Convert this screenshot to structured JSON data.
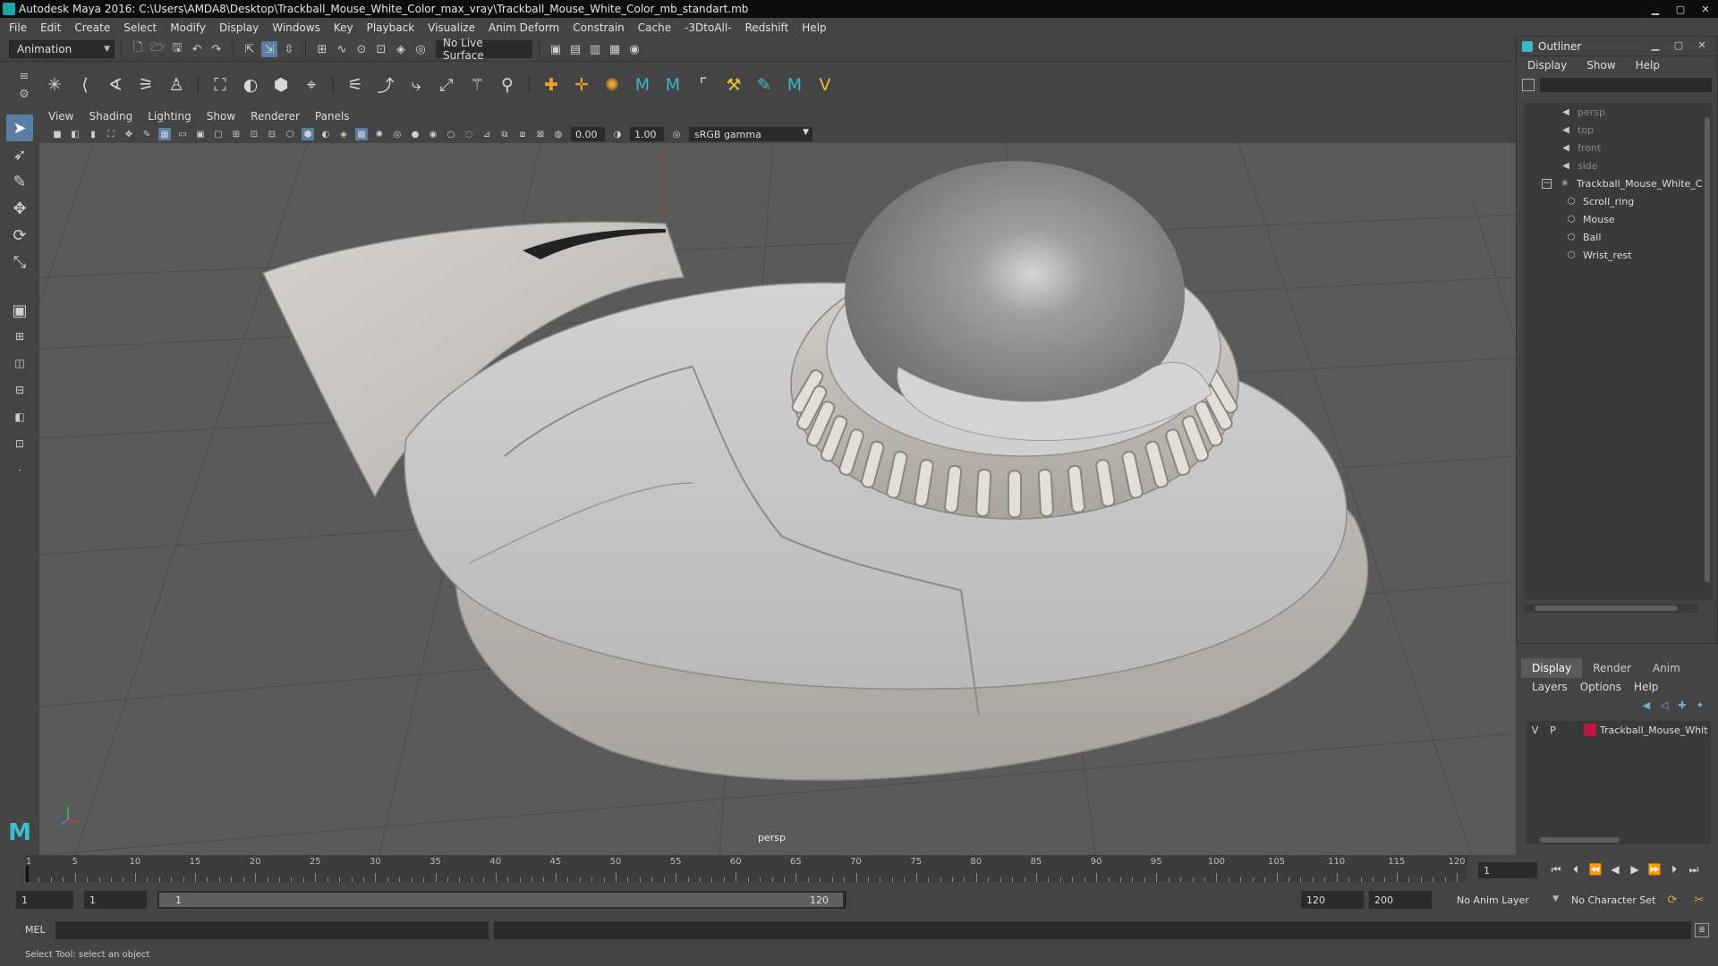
{
  "window": {
    "title": "Autodesk Maya 2016: C:\\Users\\AMDA8\\Desktop\\Trackball_Mouse_White_Color_max_vray\\Trackball_Mouse_White_Color_mb_standart.mb",
    "controls": [
      "minimize-icon",
      "maximize-icon",
      "close-icon"
    ]
  },
  "menubar": [
    "File",
    "Edit",
    "Create",
    "Select",
    "Modify",
    "Display",
    "Windows",
    "Key",
    "Playback",
    "Visualize",
    "Anim Deform",
    "Constrain",
    "Cache",
    "-3DtoAll-",
    "Redshift",
    "Help"
  ],
  "statusline": {
    "mode": "Animation",
    "live_surface": "No Live Surface"
  },
  "viewport": {
    "menus": [
      "View",
      "Shading",
      "Lighting",
      "Show",
      "Renderer",
      "Panels"
    ],
    "exposure": "0.00",
    "gamma": "1.00",
    "color_space": "sRGB gamma",
    "camera_label": "persp"
  },
  "outliner": {
    "title": "Outliner",
    "menus": [
      "Display",
      "Show",
      "Help"
    ],
    "items": [
      {
        "label": "persp",
        "type": "camera",
        "dim": true
      },
      {
        "label": "top",
        "type": "camera",
        "dim": true
      },
      {
        "label": "front",
        "type": "camera",
        "dim": true
      },
      {
        "label": "side",
        "type": "camera",
        "dim": true
      },
      {
        "label": "Trackball_Mouse_White_C",
        "type": "group",
        "expanded": true
      },
      {
        "label": "Scroll_ring",
        "type": "mesh"
      },
      {
        "label": "Mouse",
        "type": "mesh"
      },
      {
        "label": "Ball",
        "type": "mesh"
      },
      {
        "label": "Wrist_rest",
        "type": "mesh"
      }
    ]
  },
  "layers": {
    "tabs": [
      "Display",
      "Render",
      "Anim"
    ],
    "active_tab": "Display",
    "menus": [
      "Layers",
      "Options",
      "Help"
    ],
    "rows": [
      {
        "visible": "V",
        "playback": "P",
        "name": "Trackball_Mouse_Whit",
        "color": "#c0183c"
      }
    ]
  },
  "timeline": {
    "tick_labels": [
      "1",
      "5",
      "10",
      "15",
      "20",
      "25",
      "30",
      "35",
      "40",
      "45",
      "50",
      "55",
      "60",
      "65",
      "70",
      "75",
      "80",
      "85",
      "90",
      "95",
      "100",
      "105",
      "110",
      "115",
      "120"
    ],
    "current_frame": "1"
  },
  "range": {
    "start": "1",
    "playback_start": "1",
    "slider_start": "1",
    "slider_end": "120",
    "playback_end": "120",
    "end": "200",
    "anim_layer": "No Anim Layer",
    "character_set": "No Character Set"
  },
  "command": {
    "language": "MEL"
  },
  "help_line": "Select Tool: select an object"
}
